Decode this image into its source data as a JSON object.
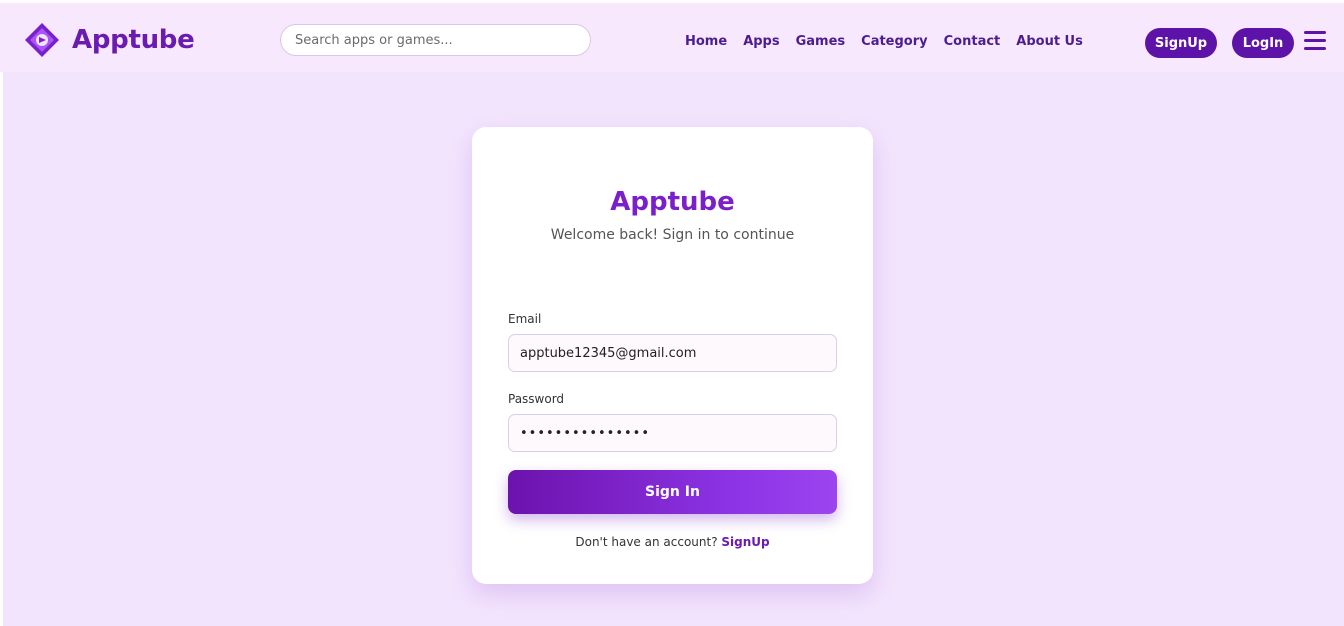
{
  "header": {
    "brand": "Apptube",
    "search_placeholder": "Search apps or games...",
    "nav": [
      "Home",
      "Apps",
      "Games",
      "Category",
      "Contact",
      "About Us"
    ],
    "signup_label": "SignUp",
    "login_label": "LogIn"
  },
  "login": {
    "title": "Apptube",
    "subtitle": "Welcome back! Sign in to continue",
    "email_label": "Email",
    "email_value": "apptube12345@gmail.com",
    "password_label": "Password",
    "password_value": "•••••••••••••••",
    "submit_label": "Sign In",
    "no_account_text": "Don't have an account?",
    "signup_link": "SignUp"
  },
  "icons": {
    "logo": "apptube-logo-icon",
    "menu": "hamburger-menu-icon"
  },
  "colors": {
    "brand_purple": "#6a1bb0",
    "button_purple": "#5e13a8",
    "page_background": "#f3e4fd"
  }
}
